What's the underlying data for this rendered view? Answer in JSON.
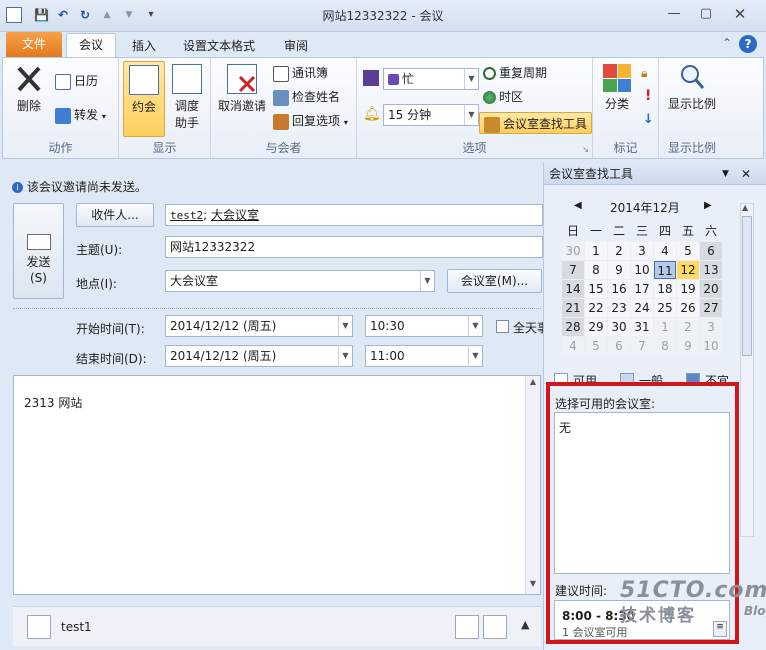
{
  "window": {
    "title": "网站12332322 - 会议"
  },
  "quick_access": {
    "save": "💾",
    "undo": "↶",
    "redo": "↻",
    "up": "▲",
    "down": "▼",
    "more": "▾"
  },
  "tabs": {
    "file": "文件",
    "meeting": "会议",
    "insert": "插入",
    "format": "设置文本格式",
    "review": "审阅"
  },
  "ribbon": {
    "actions": {
      "label": "动作",
      "delete": "删除",
      "calendar": "日历",
      "forward": "转发"
    },
    "show": {
      "label": "显示",
      "appointment": "约会",
      "scheduling_line1": "调度",
      "scheduling_line2": "助手"
    },
    "attendees": {
      "label": "与会者",
      "cancel_invite": "取消邀请",
      "address_book": "通讯簿",
      "check_names": "检查姓名",
      "response_options": "回复选项"
    },
    "options": {
      "label": "选项",
      "busy": "忙",
      "reminder": "15 分钟",
      "recurrence": "重复周期",
      "timezone": "时区",
      "room_finder": "会议室查找工具"
    },
    "tags": {
      "label": "标记",
      "categorize": "分类"
    },
    "zoom": {
      "label": "显示比例",
      "zoom": "显示比例"
    }
  },
  "form": {
    "info": "该会议邀请尚未发送。",
    "send_line1": "发送",
    "send_line2": "(S)",
    "to_button": "收件人...",
    "to_value_name": "test2",
    "to_value_room": "大会议室",
    "subject_label": "主题(U):",
    "subject_value": "网站12332322",
    "location_label": "地点(I):",
    "location_value": "大会议室",
    "rooms_button": "会议室(M)...",
    "start_label": "开始时间(T):",
    "start_date": "2014/12/12 (周五)",
    "start_time": "10:30",
    "allday": "全天事",
    "end_label": "结束时间(D):",
    "end_date": "2014/12/12 (周五)",
    "end_time": "11:00",
    "body": "2313 网站"
  },
  "people": {
    "name": "test1"
  },
  "pane": {
    "title": "会议室查找工具",
    "month": "2014年12月",
    "weekdays": [
      "日",
      "一",
      "二",
      "三",
      "四",
      "五",
      "六"
    ],
    "weeks": [
      [
        "30",
        "1",
        "2",
        "3",
        "4",
        "5",
        "6"
      ],
      [
        "7",
        "8",
        "9",
        "10",
        "11",
        "12",
        "13"
      ],
      [
        "14",
        "15",
        "16",
        "17",
        "18",
        "19",
        "20"
      ],
      [
        "21",
        "22",
        "23",
        "24",
        "25",
        "26",
        "27"
      ],
      [
        "28",
        "29",
        "30",
        "31",
        "1",
        "2",
        "3"
      ],
      [
        "4",
        "5",
        "6",
        "7",
        "8",
        "9",
        "10"
      ]
    ],
    "legend": {
      "good": "可用",
      "fair": "一般",
      "poor": "不宜"
    },
    "rooms_label": "选择可用的会议室:",
    "rooms_value": "无",
    "suggest_label": "建议时间:",
    "suggest_time": "8:00 - 8:30",
    "suggest_detail": "1 会议室可用"
  },
  "watermark": {
    "site": "51CTO.com",
    "tagline": "技术博客",
    "blog": "Blog"
  },
  "colors": {
    "accent_red": "#d1161b",
    "file_tab": "#e4781e",
    "selected_day": "#b4c8e8",
    "today": "#ffd966"
  }
}
